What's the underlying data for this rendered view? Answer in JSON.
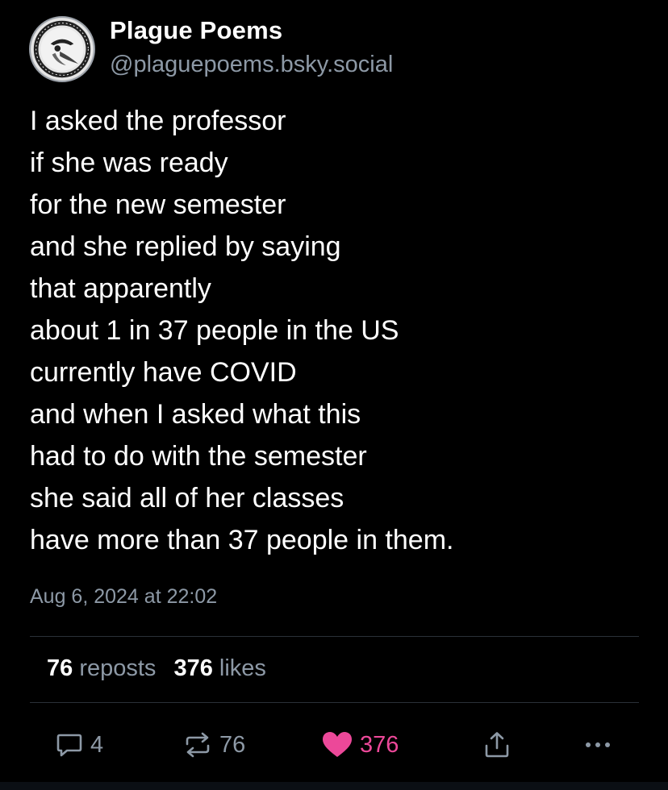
{
  "author": {
    "display_name": "Plague Poems",
    "handle": "@plaguepoems.bsky.social",
    "avatar_icon": "plague-doctor-avatar"
  },
  "post": {
    "lines": [
      "I asked the professor",
      "if she was ready",
      "for the new semester",
      "and she replied by saying",
      "that apparently",
      "about 1 in 37 people in the US",
      "currently have COVID",
      "and when I asked what this",
      "had to do with the semester",
      "she said all of her classes",
      "have more than 37 people in them."
    ],
    "timestamp": "Aug 6, 2024 at 22:02"
  },
  "stats": {
    "reposts_count": "76",
    "reposts_label": "reposts",
    "likes_count": "376",
    "likes_label": "likes"
  },
  "actions": {
    "reply_count": "4",
    "repost_count": "76",
    "like_count": "376",
    "reply_icon": "reply-icon",
    "repost_icon": "repost-icon",
    "like_icon": "heart-icon",
    "share_icon": "share-icon",
    "more_icon": "more-icon"
  },
  "colors": {
    "background": "#000000",
    "muted_text": "#8d99a6",
    "like_accent": "#ec4899"
  }
}
